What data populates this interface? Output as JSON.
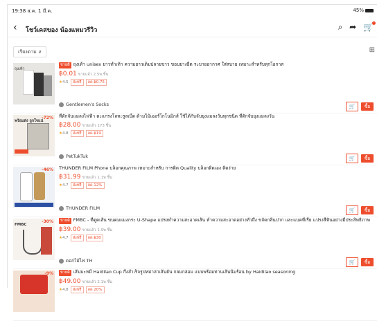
{
  "status": {
    "time": "19:38 ส.ค. 1 มี.ค.",
    "battery": "45%"
  },
  "header": {
    "back_icon": "chevron-left-icon",
    "title": "โชว์เคสของ น้องแหมวรีวิว"
  },
  "filter": {
    "label": "เรียงตาม"
  },
  "products": [
    {
      "badge": "ขายดี",
      "name": "ถุงเท้า unisex ยาวทำเท้า ความยาวเต็มปลายขาว ขอบยางยืด ระบายอากาศ ใส่สบาย เหมาะสำหรับทุกโอกาส",
      "price": "฿0.01",
      "price_note": "ขายแล้ว 2.5พ ชิ้น",
      "rating": "4.5",
      "tag1": "ส่งฟรี",
      "tag2": "ลด ฿0.75",
      "shop": "Gentlemen's Socks",
      "discount": "",
      "thumb_label": "ถุงเท้า"
    },
    {
      "badge": "",
      "name": "ที่ดักจับแมลงไฟฟ้า ตะแกรงโลหะรูลเบิ้ด ด้ามไม้เออร์โกโนมิกส์ ใช้ได้กับจับยุงแมลงวันทุกชนิด ที่ดักจับยุงแมลงวัน",
      "price": "฿28.00",
      "price_note": "ขายแล้ว 173 ชิ้น",
      "rating": "4.8",
      "tag1": "ส่งฟรี",
      "tag2": "ลด ฿19",
      "shop": "PetTukTuk",
      "discount": "-72%",
      "thumb_label": "พร้อมส่ง ถูกใจแน่"
    },
    {
      "badge": "",
      "name": "THUNDER FILM Phone บล็อกคุณภาพ เหมาะสำหรับ การติด Quality บล็อกติดเอง ติดง่าย",
      "price": "฿31.99",
      "price_note": "ขายแล้ว 1.1พ ชิ้น",
      "rating": "4.7",
      "tag1": "ส่งฟรี",
      "tag2": "ลด 12%",
      "shop": "THUNDER FILM",
      "discount": "-46%",
      "thumb_label": ""
    },
    {
      "badge": "ขายดี",
      "name": "FMBC - ที่ดูดเส้น ขนดมแมงกระ U-Shape แปรงทำความสะอาดเส้น ทำความสะอาดอย่างทั่วถึง ขจัดกลิ่นปาก และแบคทีเรีย แปรงสีฟันอย่างมีประสิทธิภาพ",
      "price": "฿39.00",
      "price_note": "ขายแล้ว 1.9พ ชิ้น",
      "rating": "4.7",
      "tag1": "ส่งฟรี",
      "tag2": "ลด ฿30",
      "shop": "ดอกไม้ไฟ TH",
      "discount": "-30%",
      "thumb_label": "FMBC"
    },
    {
      "badge": "ขายดี",
      "name": "เส้นบะหมี่ Haidilao Cup กึ่งสำเร็จรูปหม่าล่าเส้นยัน กลมกล่อม แบบพร้อมทานเส้นนิ่มร้อน by Haidilao seasoning",
      "price": "฿49.00",
      "price_note": "ขายแล้ว 2.1พ ชิ้น",
      "rating": "4.8",
      "tag1": "ส่งฟรี",
      "tag2": "ลด 20%",
      "shop": "",
      "discount": "-9%",
      "thumb_label": ""
    }
  ],
  "actions": {
    "buy_label": "ซื้อ",
    "cart_icon": "add-to-cart-icon"
  },
  "colors": {
    "accent": "#ee4d2d"
  }
}
